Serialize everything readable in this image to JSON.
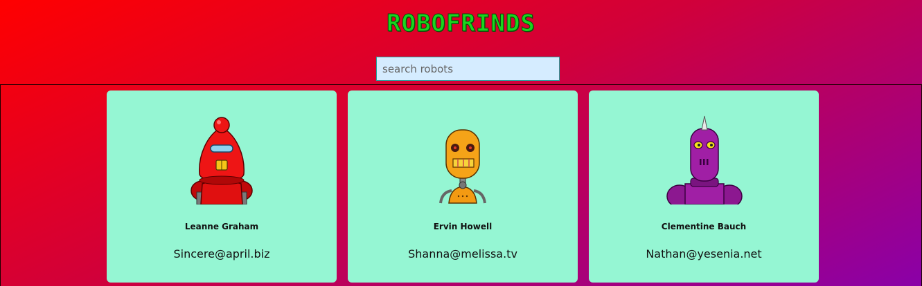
{
  "app": {
    "title": "ROBOFRINDS"
  },
  "search": {
    "placeholder": "search robots",
    "value": ""
  },
  "robots": [
    {
      "name": "Leanne Graham",
      "email": "Sincere@april.biz",
      "avatar": "red-robot-icon",
      "color": "#e81010"
    },
    {
      "name": "Ervin Howell",
      "email": "Shanna@melissa.tv",
      "avatar": "orange-robot-icon",
      "color": "#f39a12"
    },
    {
      "name": "Clementine Bauch",
      "email": "Nathan@yesenia.net",
      "avatar": "purple-robot-icon",
      "color": "#9b1a9e"
    }
  ],
  "colors": {
    "background_start": "#ff0000",
    "background_end": "#8a00a8",
    "card": "#95f6d3",
    "title": "#19d61e",
    "search_bg": "#d5ecff"
  }
}
